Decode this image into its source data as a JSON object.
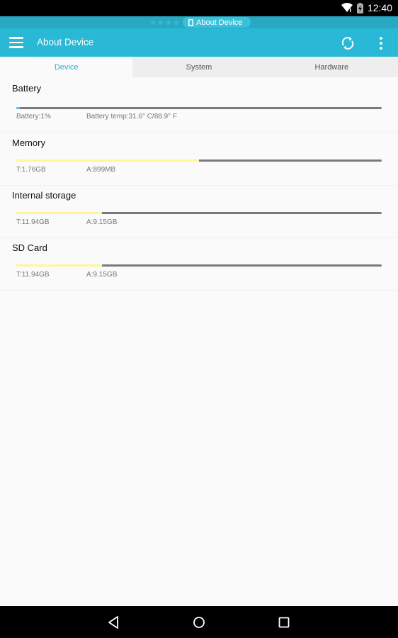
{
  "status_bar": {
    "time": "12:40",
    "icons": [
      "wifi-icon",
      "battery-charging-icon"
    ]
  },
  "notification": {
    "label": "About Device",
    "icon": "phone-icon"
  },
  "toolbar": {
    "title": "About Device",
    "menu_icon": "hamburger-icon",
    "refresh_icon": "refresh-icon",
    "more_icon": "more-vert-icon"
  },
  "tabs": [
    {
      "label": "Device",
      "active": true
    },
    {
      "label": "System",
      "active": false
    },
    {
      "label": "Hardware",
      "active": false
    }
  ],
  "colors": {
    "accent": "#29b8d5",
    "battery_fill": "#4fc3f7",
    "usage_fill": "#fff59d",
    "track": "#7a7a7a"
  },
  "sections": {
    "battery": {
      "title": "Battery",
      "level_label": "Battery:1%",
      "temp_label": "Battery temp:31.6° C/88.9° F",
      "fill_fraction": 0.01
    },
    "memory": {
      "title": "Memory",
      "total": "T:1.76GB",
      "available": "A:899MB",
      "fill_fraction": 0.5
    },
    "internal": {
      "title": "Internal storage",
      "total": "T:11.94GB",
      "available": "A:9.15GB",
      "fill_fraction": 0.234
    },
    "sdcard": {
      "title": "SD Card",
      "total": "T:11.94GB",
      "available": "A:9.15GB",
      "fill_fraction": 0.234
    }
  },
  "nav": {
    "back": "back-icon",
    "home": "home-icon",
    "recents": "recents-icon"
  }
}
